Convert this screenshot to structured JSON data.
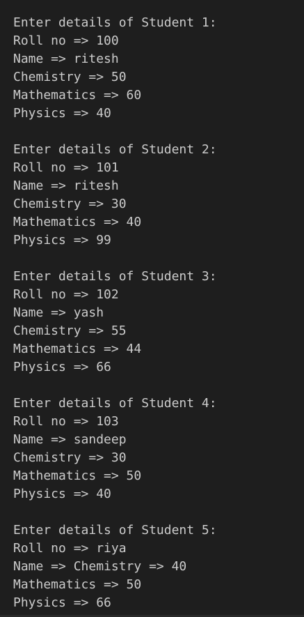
{
  "terminal": {
    "blocks": [
      {
        "header": "Enter details of Student 1:",
        "lines": [
          "Roll no => 100",
          "Name => ritesh",
          "Chemistry => 50",
          "Mathematics => 60",
          "Physics => 40"
        ]
      },
      {
        "header": "Enter details of Student 2:",
        "lines": [
          "Roll no => 101",
          "Name => ritesh",
          "Chemistry => 30",
          "Mathematics => 40",
          "Physics => 99"
        ]
      },
      {
        "header": "Enter details of Student 3:",
        "lines": [
          "Roll no => 102",
          "Name => yash",
          "Chemistry => 55",
          "Mathematics => 44",
          "Physics => 66"
        ]
      },
      {
        "header": "Enter details of Student 4:",
        "lines": [
          "Roll no => 103",
          "Name => sandeep",
          "Chemistry => 30",
          "Mathematics => 50",
          "Physics => 40"
        ]
      },
      {
        "header": "Enter details of Student 5:",
        "lines": [
          "Roll no => riya",
          "Name => Chemistry => 40",
          "Mathematics => 50",
          "Physics => 66"
        ]
      }
    ]
  },
  "colors": {
    "background": "#1e1e1e",
    "text": "#cccccc"
  }
}
